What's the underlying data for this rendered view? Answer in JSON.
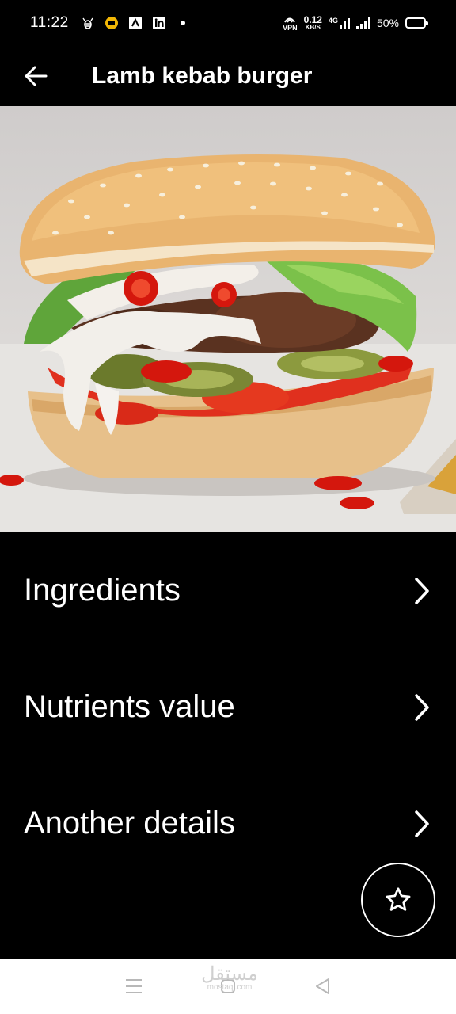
{
  "status_bar": {
    "time": "11:22",
    "vpn_label": "VPN",
    "speed_value": "0.12",
    "speed_unit": "KB/S",
    "network_type": "4G",
    "battery_text": "50%",
    "left_icons": [
      "bee-icon",
      "circle-app-icon",
      "app-icon",
      "linkedin-icon",
      "dot-icon"
    ]
  },
  "app_bar": {
    "title": "Lamb kebab burger",
    "back_icon": "arrow-left-icon"
  },
  "hero": {
    "subject": "burger-photo"
  },
  "menu": {
    "items": [
      {
        "label": "Ingredients"
      },
      {
        "label": "Nutrients value"
      },
      {
        "label": "Another details"
      }
    ]
  },
  "fab": {
    "icon": "star-outline-icon"
  },
  "nav_bar": {
    "watermark": "مستقل",
    "watermark_sub": "mostaql.com"
  },
  "colors": {
    "background": "#000000",
    "text": "#ffffff",
    "nav_bar": "#ffffff",
    "nav_icons": "#b8b8b8"
  }
}
